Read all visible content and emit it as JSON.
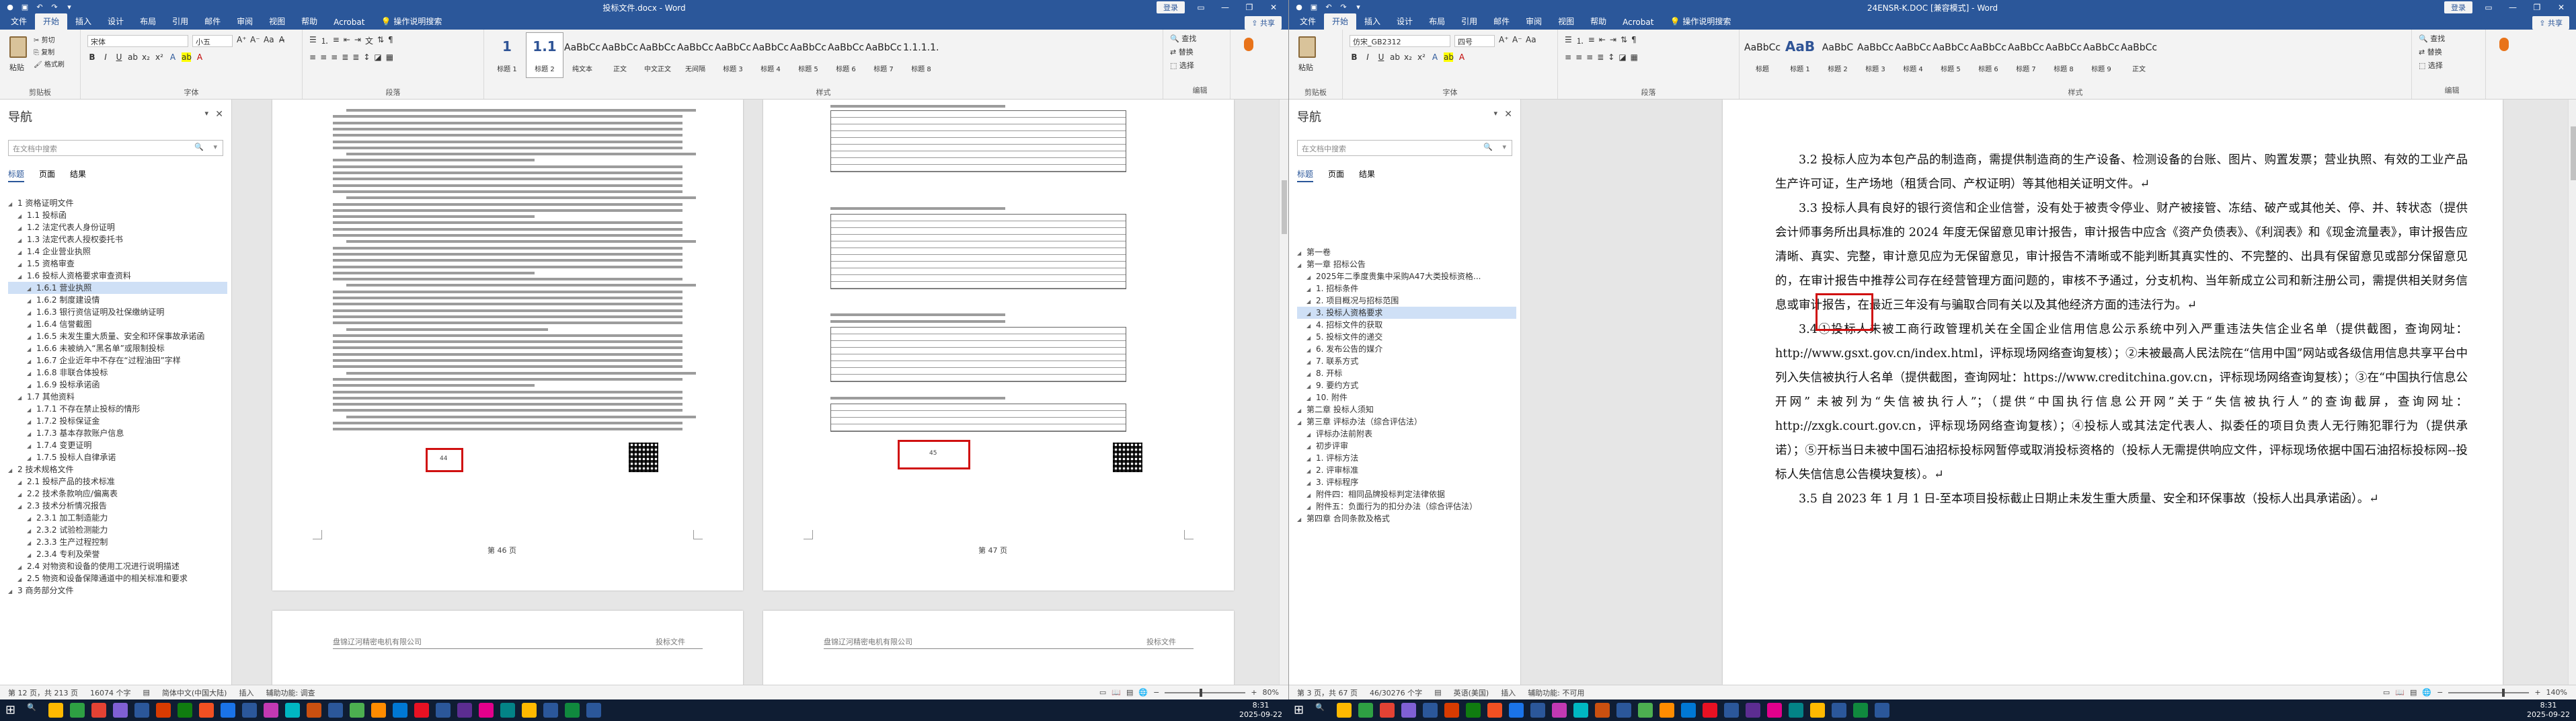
{
  "left_window": {
    "title": "投标文件.docx - Word",
    "login_label": "登录",
    "share_label": "共享",
    "tabs": [
      "文件",
      "开始",
      "插入",
      "设计",
      "布局",
      "引用",
      "邮件",
      "审阅",
      "视图",
      "帮助",
      "Acrobat"
    ],
    "active_tab": "开始",
    "tell_me": "操作说明搜索",
    "ribbon": {
      "clipboard_label": "剪贴板",
      "paste_label": "粘贴",
      "cut": "剪切",
      "copy": "复制",
      "format_painter": "格式刷",
      "font_label": "字体",
      "font_name": "宋体",
      "font_size": "小五",
      "paragraph_label": "段落",
      "styles_label": "样式",
      "editing_label": "编辑",
      "find": "查找",
      "replace": "替换",
      "select": "选择",
      "styles": [
        {
          "sample": "1",
          "name": "标题 1"
        },
        {
          "sample": "1.1",
          "name": "标题 2"
        },
        {
          "sample": "AaBbCcDd",
          "name": "纯文本"
        },
        {
          "sample": "AaBbCcDd",
          "name": "正文"
        },
        {
          "sample": "AaBbCcDd",
          "name": "中文正文"
        },
        {
          "sample": "AaBbCcDd",
          "name": "无间隔"
        },
        {
          "sample": "AaBbCcDd",
          "name": "标题 3"
        },
        {
          "sample": "AaBbCcDd",
          "name": "标题 4"
        },
        {
          "sample": "AaBbCcDd",
          "name": "标题 5"
        },
        {
          "sample": "AaBbCcDd",
          "name": "标题 6"
        },
        {
          "sample": "AaBbCcDd",
          "name": "标题 7"
        },
        {
          "sample": "1.1.1.1.1.1",
          "name": "标题 8"
        }
      ]
    },
    "nav": {
      "title": "导航",
      "search_placeholder": "在文档中搜索",
      "tabs": [
        "标题",
        "页面",
        "结果"
      ],
      "items": [
        {
          "t": "1 资格证明文件",
          "lvl": 0
        },
        {
          "t": "1.1 投标函",
          "lvl": 1
        },
        {
          "t": "1.2 法定代表人身份证明",
          "lvl": 1
        },
        {
          "t": "1.3 法定代表人授权委托书",
          "lvl": 1
        },
        {
          "t": "1.4 企业营业执照",
          "lvl": 1
        },
        {
          "t": "1.5 资格审查",
          "lvl": 1
        },
        {
          "t": "1.6 投标人资格要求审查资料",
          "lvl": 1
        },
        {
          "t": "1.6.1 营业执照",
          "lvl": 2,
          "sel": true
        },
        {
          "t": "1.6.2 制度建设情",
          "lvl": 2
        },
        {
          "t": "1.6.3 银行资信证明及社保缴纳证明",
          "lvl": 2
        },
        {
          "t": "1.6.4 信誉截图",
          "lvl": 2
        },
        {
          "t": "1.6.5 未发生重大质量、安全和环保事故承诺函",
          "lvl": 2
        },
        {
          "t": "1.6.6 未被纳入“黑名单”或限制投标",
          "lvl": 2
        },
        {
          "t": "1.6.7 企业近年中不存在“过程油田”字样",
          "lvl": 2
        },
        {
          "t": "1.6.8 非联合体投标",
          "lvl": 2
        },
        {
          "t": "1.6.9 投标承诺函",
          "lvl": 2
        },
        {
          "t": "1.7 其他资料",
          "lvl": 1
        },
        {
          "t": "1.7.1 不存在禁止投标的情形",
          "lvl": 2
        },
        {
          "t": "1.7.2 投标保证金",
          "lvl": 2
        },
        {
          "t": "1.7.3 基本存款账户信息",
          "lvl": 2
        },
        {
          "t": "1.7.4 变更证明",
          "lvl": 2
        },
        {
          "t": "1.7.5 投标人自律承诺",
          "lvl": 2
        },
        {
          "t": "2 技术规格文件",
          "lvl": 0
        },
        {
          "t": "2.1 投标产品的技术标准",
          "lvl": 1
        },
        {
          "t": "2.2 技术条款响应/偏离表",
          "lvl": 1
        },
        {
          "t": "2.3 技术分析情况报告",
          "lvl": 1
        },
        {
          "t": "2.3.1 加工制造能力",
          "lvl": 2
        },
        {
          "t": "2.3.2 试验检测能力",
          "lvl": 2
        },
        {
          "t": "2.3.3 生产过程控制",
          "lvl": 2
        },
        {
          "t": "2.3.4 专利及荣誉",
          "lvl": 2
        },
        {
          "t": "2.4 对物资和设备的使用工况进行说明描述",
          "lvl": 1
        },
        {
          "t": "2.5 物资和设备保障通道中的相关标准和要求",
          "lvl": 1
        },
        {
          "t": "3 商务部分文件",
          "lvl": 0
        }
      ]
    },
    "pages": {
      "left_page_number": "第 46 页",
      "right_page_number": "第 47 页",
      "left_box_text": "44",
      "right_box_text": "45",
      "footer_company": "盘锦辽河精密电机有限公司",
      "footer_doc": "投标文件"
    },
    "status": {
      "page": "第 12 页，共 213 页",
      "words": "16074 个字",
      "lang": "简体中文(中国大陆)",
      "insert": "插入",
      "accessibility": "辅助功能: 调查",
      "zoom": "80%"
    }
  },
  "right_window": {
    "title": "24ENSR-K.DOC [兼容模式] - Word",
    "login_label": "登录",
    "share_label": "共享",
    "tabs": [
      "文件",
      "开始",
      "插入",
      "设计",
      "布局",
      "引用",
      "邮件",
      "审阅",
      "视图",
      "帮助",
      "Acrobat"
    ],
    "active_tab": "开始",
    "tell_me": "操作说明搜索",
    "ribbon": {
      "clipboard_label": "剪贴板",
      "paste_label": "粘贴",
      "font_label": "字体",
      "font_name": "仿宋_GB2312",
      "font_size": "四号",
      "paragraph_label": "段落",
      "styles_label": "样式",
      "editing_label": "编辑",
      "find": "查找",
      "replace": "替换",
      "select": "选择",
      "styles": [
        {
          "sample": "AaBbCc",
          "name": "标题"
        },
        {
          "sample": "AaB",
          "name": "标题 1"
        },
        {
          "sample": "AaBbC",
          "name": "标题 2"
        },
        {
          "sample": "AaBbCcD",
          "name": "标题 3"
        },
        {
          "sample": "AaBbCcD",
          "name": "标题 4"
        },
        {
          "sample": "AaBbCcD",
          "name": "标题 5"
        },
        {
          "sample": "AaBbCcD",
          "name": "标题 6"
        },
        {
          "sample": "AaBbCcD",
          "name": "标题 7"
        },
        {
          "sample": "AaBbCcD",
          "name": "标题 8"
        },
        {
          "sample": "AaBbCcD",
          "name": "标题 9"
        },
        {
          "sample": "AaBbCc",
          "name": "正文"
        }
      ]
    },
    "nav": {
      "title": "导航",
      "search_placeholder": "在文档中搜索",
      "tabs": [
        "标题",
        "页面",
        "结果"
      ],
      "items": [
        {
          "t": "第一卷",
          "lvl": 0
        },
        {
          "t": "第一章 招标公告",
          "lvl": 0
        },
        {
          "t": "2025年二季度贵集中采购A47大类投标资格...",
          "lvl": 1
        },
        {
          "t": "1. 招标条件",
          "lvl": 1
        },
        {
          "t": "2. 项目概况与招标范围",
          "lvl": 1
        },
        {
          "t": "3. 投标人资格要求",
          "lvl": 1,
          "sel": true
        },
        {
          "t": "4. 招标文件的获取",
          "lvl": 1
        },
        {
          "t": "5. 投标文件的递交",
          "lvl": 1
        },
        {
          "t": "6. 发布公告的媒介",
          "lvl": 1
        },
        {
          "t": "7. 联系方式",
          "lvl": 1
        },
        {
          "t": "8. 开标",
          "lvl": 1
        },
        {
          "t": "9. 要约方式",
          "lvl": 1
        },
        {
          "t": "10. 附件",
          "lvl": 1
        },
        {
          "t": "第二章 投标人须知",
          "lvl": 0
        },
        {
          "t": "第三章 评标办法（综合评估法）",
          "lvl": 0
        },
        {
          "t": "评标办法前附表",
          "lvl": 1
        },
        {
          "t": "初步评审",
          "lvl": 1
        },
        {
          "t": "1. 评标方法",
          "lvl": 1
        },
        {
          "t": "2. 评审标准",
          "lvl": 1
        },
        {
          "t": "3. 评标程序",
          "lvl": 1
        },
        {
          "t": "附件四：相同品牌投标判定法律依据",
          "lvl": 1
        },
        {
          "t": "附件五：负面行为的扣分办法（综合评估法）",
          "lvl": 1
        },
        {
          "t": "第四章 合同条款及格式",
          "lvl": 0
        }
      ]
    },
    "paragraphs": [
      "3.2 投标人应为本包产品的制造商，需提供制造商的生产设备、检测设备的台账、图片、购置发票；营业执照、有效的工业产品生产许可证，生产场地（租赁合同、产权证明）等其他相关证明文件。↵",
      "3.3 投标人具有良好的银行资信和企业信誉，没有处于被责令停业、财产被接管、冻结、破产或其他关、停、并、转状态（提供会计师事务所出具标准的 2024 年度无保留意见审计报告，审计报告中应含《资产负债表》、《利润表》和《现金流量表》，审计报告应清晰、真实、完整，审计意见应为无保留意见，审计报告不清晰或不能判断其真实性的、不完整的、出具有保留意见或部分保留意见的，在审计报告中推荐公司存在经营管理方面问题的，审核不予通过，分支机构、当年新成立公司和新注册公司，需提供相关财务信息或审计报告，在最近三年没有与骗取合同有关以及其他经济方面的违法行为。↵",
      "3.4①投标人未被工商行政管理机关在全国企业信用信息公示系统中列入严重违法失信企业名单（提供截图，查询网址：http://www.gsxt.gov.cn/index.html，评标现场网络查询复核）；②未被最高人民法院在“信用中国”网站或各级信用信息共享平台中列入失信被执行人名单（提供截图，查询网址：https://www.creditchina.gov.cn，评标现场网络查询复核）；③在“中国执行信息公开网” 未被列为“失信被执行人”；（提供“中国执行信息公开网”关于“失信被执行人”的查询截屏，查询网址：http://zxgk.court.gov.cn，评标现场网络查询复核）；④投标人或其法定代表人、拟委任的项目负责人无行贿犯罪行为（提供承诺）；⑤开标当日未被中国石油招标投标网暂停或取消投标资格的（投标人无需提供响应文件，评标现场依据中国石油招标投标网--投标人失信信息公告模块复核）。↵",
      "3.5 自 2023 年 1 月 1 日-至本项目投标截止日期止未发生重大质量、安全和环保事故（投标人出具承诺函）。↵"
    ],
    "status": {
      "page": "第 3 页，共 67 页",
      "words": "46/30276 个字",
      "lang": "英语(美国)",
      "insert": "插入",
      "accessibility": "辅助功能: 不可用",
      "zoom": "140%"
    }
  },
  "taskbar": {
    "left_time": "8:31",
    "left_date": "2025-09-22",
    "right_time": "8:31",
    "right_date": "2025-09-22"
  }
}
